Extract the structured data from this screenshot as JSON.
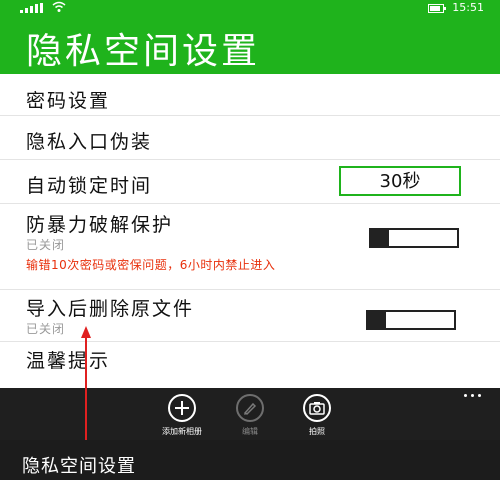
{
  "status_bar": {
    "time": "15:51"
  },
  "header": {
    "title": "隐私空间设置"
  },
  "settings": {
    "password": {
      "label": "密码设置"
    },
    "disguise": {
      "label": "隐私入口伪装"
    },
    "autolock": {
      "label": "自动锁定时间",
      "value": "30秒"
    },
    "brute_force": {
      "label": "防暴力破解保护",
      "status": "已关闭",
      "warning": "输错10次密码或密保问题，6小时内禁止进入",
      "enabled": false
    },
    "delete_original": {
      "label": "导入后删除原文件",
      "status": "已关闭",
      "enabled": false
    },
    "tips": {
      "label": "温馨提示"
    }
  },
  "app_bar": {
    "add_album": "添加新相册",
    "edit": "编辑",
    "photo": "拍照"
  },
  "caption": {
    "text": "隐私空间设置"
  },
  "colors": {
    "accent": "#1fb31c",
    "warning": "#e8300c",
    "appbar": "#1f1f1f",
    "annotation": "#e02020"
  }
}
